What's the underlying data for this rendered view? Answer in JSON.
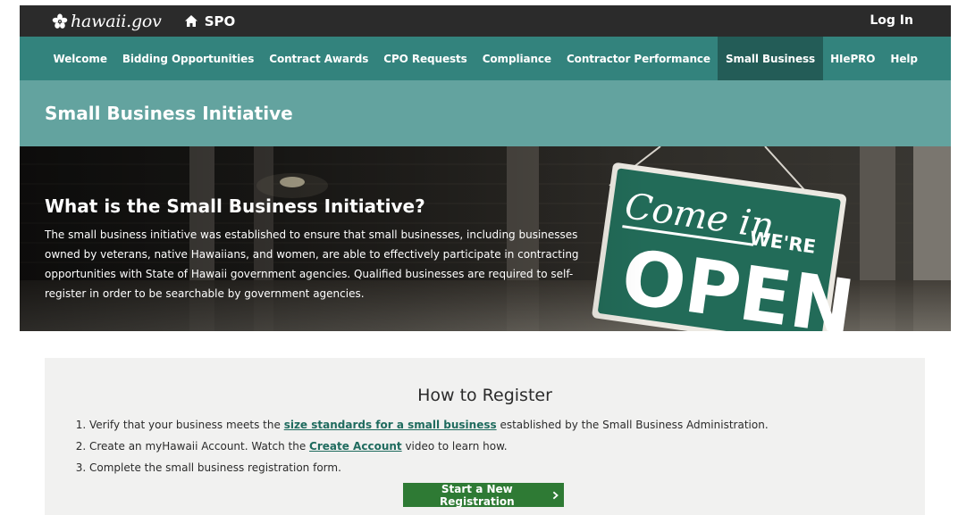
{
  "header": {
    "logo_text": "hawaii.gov",
    "section_label": "SPO",
    "login_label": "Log In"
  },
  "nav": {
    "items": [
      {
        "label": "Welcome"
      },
      {
        "label": "Bidding Opportunities"
      },
      {
        "label": "Contract Awards"
      },
      {
        "label": "CPO Requests"
      },
      {
        "label": "Compliance"
      },
      {
        "label": "Contractor Performance"
      },
      {
        "label": "Small Business",
        "active": true
      },
      {
        "label": "HIePRO"
      },
      {
        "label": "Help"
      }
    ]
  },
  "page": {
    "title": "Small Business Initiative"
  },
  "hero": {
    "heading": "What is the Small Business Initiative?",
    "body_line1": "The small business initiative was established to ensure that small businesses, including businesses",
    "body_line2": "owned by veterans, native Hawaiians, and women, are able to effectively participate in contracting",
    "body_line3": "opportunities with State of Hawaii government agencies. Qualified businesses are required to self-",
    "body_line4": "register in order to be searchable by government agencies.",
    "sign_script": "Come in",
    "sign_small": "WE'RE",
    "sign_big": "OPEN"
  },
  "register": {
    "title": "How to Register",
    "step1_before": "Verify that your business meets the ",
    "step1_link": "size standards for a small business",
    "step1_after": " established by the Small Business Administration.",
    "step2_before": "Create an myHawaii Account. Watch the ",
    "step2_link": "Create Account",
    "step2_after": " video to learn how.",
    "step3": "Complete the small business registration form.",
    "button_label": "Start a New Registration"
  },
  "colors": {
    "topbar": "#2b2b2b",
    "nav": "#33837d",
    "nav_active": "#235c57",
    "title_band": "#63a39f",
    "link": "#1f6b5e",
    "cta": "#2e7a34",
    "panel": "#f1f1f0"
  },
  "icons": {
    "logo": "hibiscus-icon",
    "section": "home-icon",
    "cta": "chevron-right-icon"
  }
}
